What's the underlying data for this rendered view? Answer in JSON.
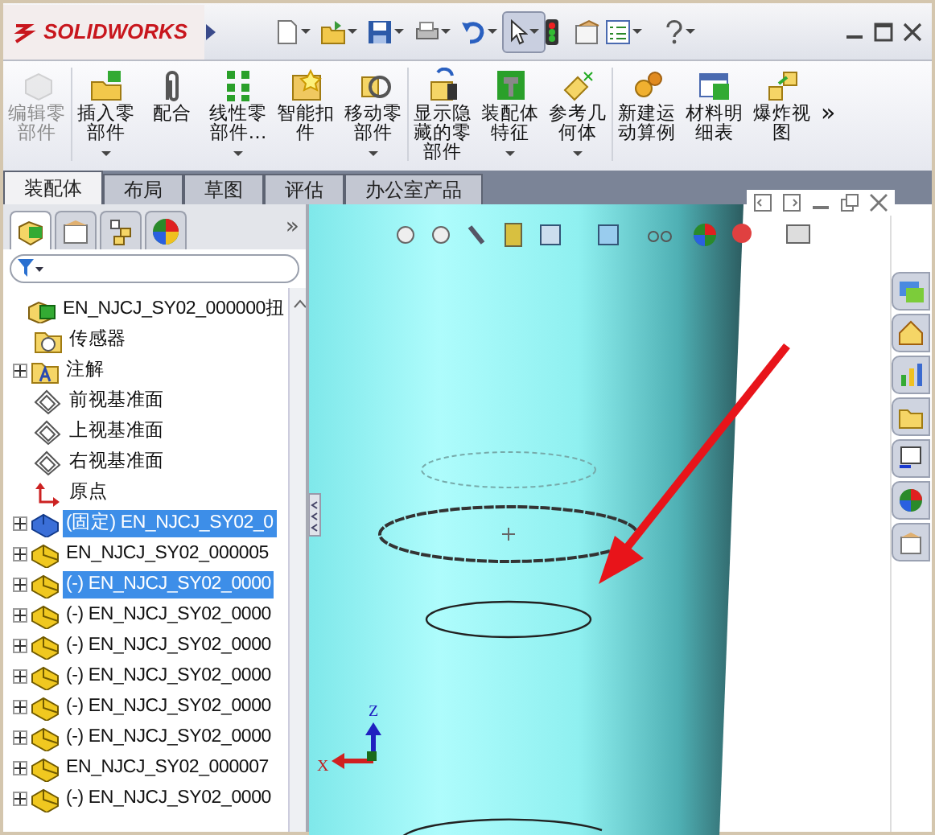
{
  "app": {
    "logo": "SOLIDWORKS"
  },
  "ribbon": [
    {
      "lines": [
        "编辑零",
        "部件"
      ],
      "disabled": true,
      "dropdown": false
    },
    {
      "lines": [
        "插入零",
        "部件"
      ],
      "disabled": false,
      "dropdown": true
    },
    {
      "lines": [
        "配合"
      ],
      "disabled": false,
      "dropdown": false
    },
    {
      "lines": [
        "线性零",
        "部件…"
      ],
      "disabled": false,
      "dropdown": true
    },
    {
      "lines": [
        "智能扣",
        "件"
      ],
      "disabled": false,
      "dropdown": false
    },
    {
      "lines": [
        "移动零",
        "部件"
      ],
      "disabled": false,
      "dropdown": true
    },
    {
      "lines": [
        "显示隐",
        "藏的零",
        "部件"
      ],
      "disabled": false,
      "dropdown": false
    },
    {
      "lines": [
        "装配体",
        "特征"
      ],
      "disabled": false,
      "dropdown": true
    },
    {
      "lines": [
        "参考几",
        "何体"
      ],
      "disabled": false,
      "dropdown": true
    },
    {
      "lines": [
        "新建运",
        "动算例"
      ],
      "disabled": false,
      "dropdown": false
    },
    {
      "lines": [
        "材料明",
        "细表"
      ],
      "disabled": false,
      "dropdown": false
    },
    {
      "lines": [
        "爆炸视",
        "图"
      ],
      "disabled": false,
      "dropdown": false
    }
  ],
  "ribbon_more": "»",
  "tabs": [
    {
      "label": "装配体",
      "selected": true
    },
    {
      "label": "布局",
      "selected": false
    },
    {
      "label": "草图",
      "selected": false
    },
    {
      "label": "评估",
      "selected": false
    },
    {
      "label": "办公室产品",
      "selected": false
    }
  ],
  "panel_tabs": [
    {
      "selected": true
    },
    {
      "selected": false
    },
    {
      "selected": false
    },
    {
      "selected": false
    }
  ],
  "panel_more": "»",
  "tree": {
    "label": "EN_NJCJ_SY02_000000扭",
    "kind": "assembly",
    "children": [
      {
        "label": "传感器",
        "kind": "sensor",
        "expandable": false,
        "selected": false
      },
      {
        "label": "注解",
        "kind": "annotation",
        "expandable": true,
        "selected": false
      },
      {
        "label": "前视基准面",
        "kind": "plane",
        "expandable": false,
        "selected": false
      },
      {
        "label": "上视基准面",
        "kind": "plane",
        "expandable": false,
        "selected": false
      },
      {
        "label": "右视基准面",
        "kind": "plane",
        "expandable": false,
        "selected": false
      },
      {
        "label": "原点",
        "kind": "origin",
        "expandable": false,
        "selected": false
      },
      {
        "label": "(固定) EN_NJCJ_SY02_0",
        "kind": "part-active",
        "expandable": true,
        "selected": true
      },
      {
        "label": "EN_NJCJ_SY02_000005",
        "kind": "part",
        "expandable": true,
        "selected": false
      },
      {
        "label": "(-) EN_NJCJ_SY02_0000",
        "kind": "part",
        "expandable": true,
        "selected": true
      },
      {
        "label": "(-) EN_NJCJ_SY02_0000",
        "kind": "part",
        "expandable": true,
        "selected": false
      },
      {
        "label": "(-) EN_NJCJ_SY02_0000",
        "kind": "part",
        "expandable": true,
        "selected": false
      },
      {
        "label": "(-) EN_NJCJ_SY02_0000",
        "kind": "part",
        "expandable": true,
        "selected": false
      },
      {
        "label": "(-) EN_NJCJ_SY02_0000",
        "kind": "part",
        "expandable": true,
        "selected": false
      },
      {
        "label": "(-) EN_NJCJ_SY02_0000",
        "kind": "part",
        "expandable": true,
        "selected": false
      },
      {
        "label": "EN_NJCJ_SY02_000007",
        "kind": "part",
        "expandable": true,
        "selected": false
      },
      {
        "label": "(-) EN_NJCJ_SY02_0000",
        "kind": "part",
        "expandable": true,
        "selected": false
      }
    ]
  },
  "triad": {
    "z": "Z",
    "x": "X"
  }
}
